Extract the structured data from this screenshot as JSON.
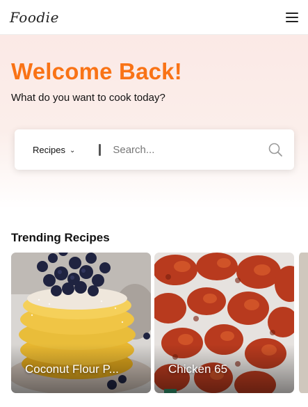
{
  "header": {
    "logo": "Foodie",
    "menu_icon": "hamburger-menu-icon"
  },
  "hero": {
    "title": "Welcome Back!",
    "subtitle": "What do you want to cook today?",
    "title_color": "#f97316"
  },
  "search": {
    "category": "Recipes",
    "category_icon": "chevron-down-icon",
    "placeholder": "Search...",
    "button_icon": "search-icon"
  },
  "trending": {
    "title": "Trending Recipes",
    "cards": [
      {
        "title": "Coconut Flour P..."
      },
      {
        "title": "Chicken 65"
      }
    ]
  }
}
